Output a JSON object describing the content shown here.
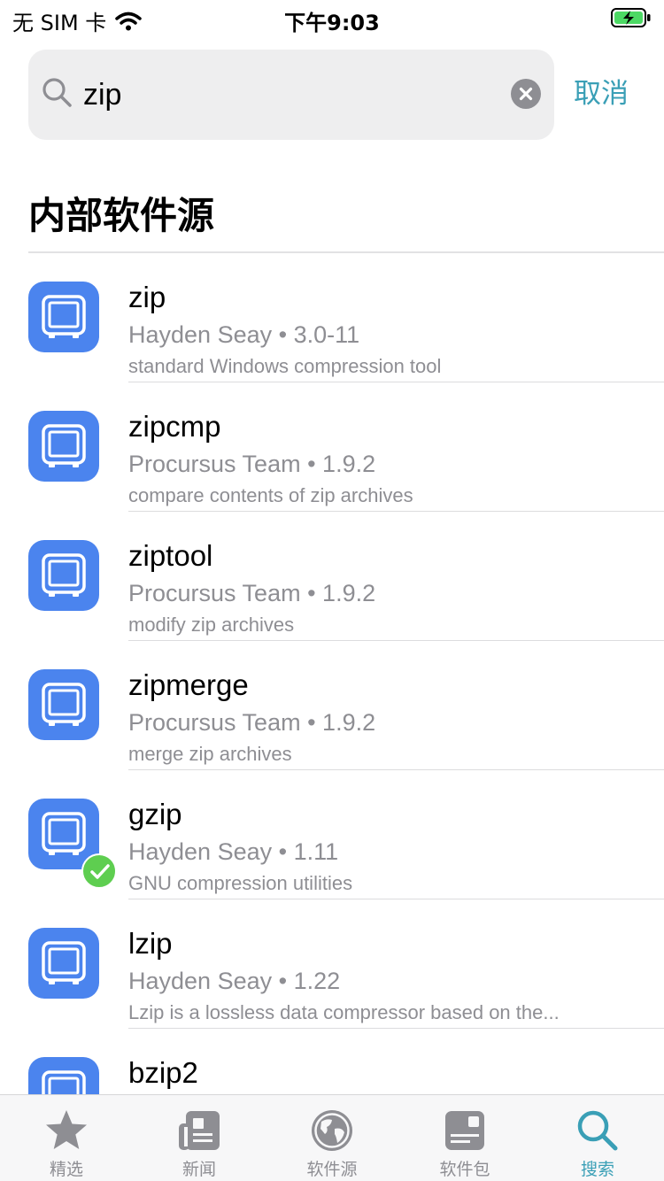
{
  "status_bar": {
    "carrier": "无 SIM 卡",
    "time": "下午9:03"
  },
  "search": {
    "query": "zip",
    "cancel_label": "取消"
  },
  "section": {
    "title": "内部软件源"
  },
  "results": [
    {
      "name": "zip",
      "author": "Hayden Seay",
      "version": "3.0-11",
      "description": "standard Windows compression tool",
      "installed": false
    },
    {
      "name": "zipcmp",
      "author": "Procursus Team",
      "version": "1.9.2",
      "description": "compare contents of zip archives",
      "installed": false
    },
    {
      "name": "ziptool",
      "author": "Procursus Team",
      "version": "1.9.2",
      "description": "modify zip archives",
      "installed": false
    },
    {
      "name": "zipmerge",
      "author": "Procursus Team",
      "version": "1.9.2",
      "description": "merge zip archives",
      "installed": false
    },
    {
      "name": "gzip",
      "author": "Hayden Seay",
      "version": "1.11",
      "description": "GNU compression utilities",
      "installed": true
    },
    {
      "name": "lzip",
      "author": "Hayden Seay",
      "version": "1.22",
      "description": "Lzip is a lossless data compressor based on the...",
      "installed": false
    },
    {
      "name": "bzip2",
      "author": "",
      "version": "",
      "description": "",
      "installed": false
    }
  ],
  "tabs": [
    {
      "label": "精选",
      "icon": "star-icon",
      "active": false
    },
    {
      "label": "新闻",
      "icon": "newspaper-icon",
      "active": false
    },
    {
      "label": "软件源",
      "icon": "globe-icon",
      "active": false
    },
    {
      "label": "软件包",
      "icon": "package-icon",
      "active": false
    },
    {
      "label": "搜索",
      "icon": "search-icon",
      "active": true
    }
  ],
  "colors": {
    "accent": "#3a9fb6",
    "app_icon": "#4b84ee",
    "installed_badge": "#5ece50",
    "secondary_text": "#8e8e93",
    "battery_charging": "#4cd964"
  }
}
